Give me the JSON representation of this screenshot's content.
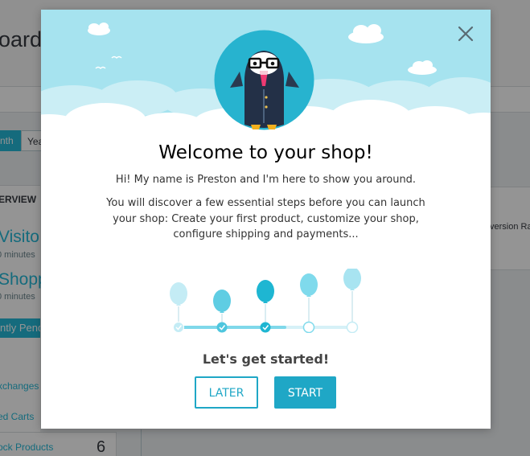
{
  "background": {
    "page_title": "oard",
    "period_active": "nth",
    "period_next": "Yea",
    "overview_label": "ERVIEW",
    "visitors_label": "Visito",
    "visitors_sub": "0 minutes",
    "shopping_label": "Shopp",
    "shopping_sub": "0 minutes",
    "pending_label": "ntly Pend",
    "links": [
      "xchanges",
      "ed Carts",
      "ock Products"
    ],
    "out_of_stock_count": "6",
    "conversion_label": "version Ra"
  },
  "modal": {
    "close_icon": "close-icon",
    "mascot": "preston-puffin-mascot",
    "title": "Welcome to your shop!",
    "intro": "Hi! My name is Preston and I'm here to show you around.",
    "description": "You will discover a few essential steps before you can launch your shop: Create your first product, customize your shop, configure shipping and payments...",
    "progress": {
      "total_steps": 5,
      "completed_steps": 3
    },
    "get_started": "Let's get started!",
    "later_button": "LATER",
    "start_button": "START"
  },
  "colors": {
    "accent": "#1fa7c6",
    "sky": "#a6e3ef",
    "overlay": "rgba(0,0,0,0.42)"
  }
}
